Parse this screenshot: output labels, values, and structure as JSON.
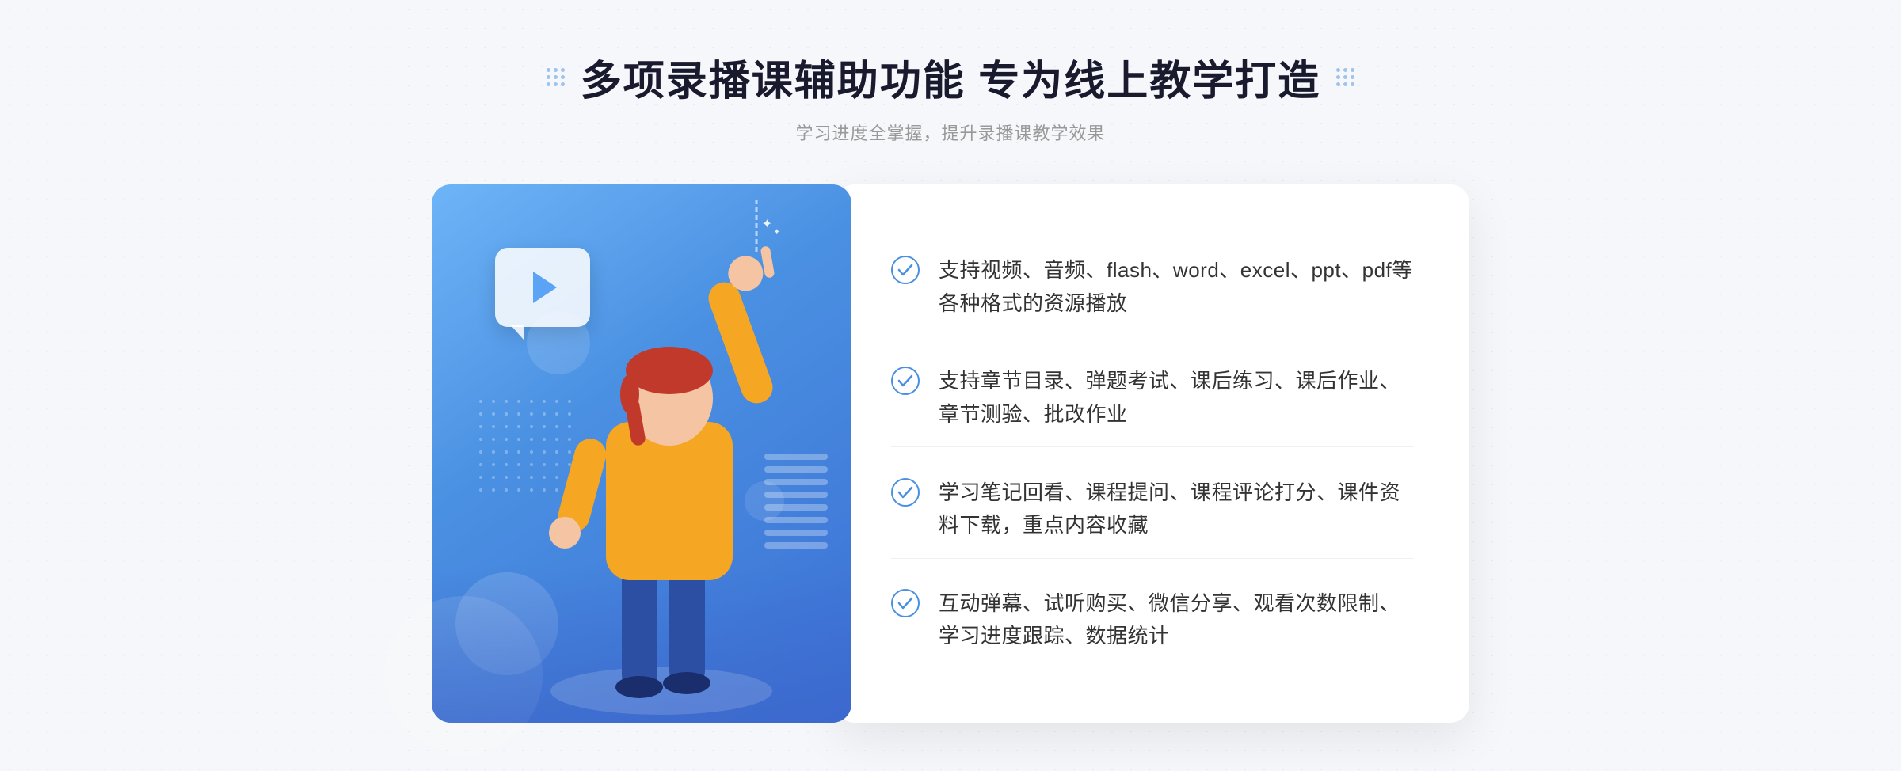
{
  "header": {
    "title": "多项录播课辅助功能 专为线上教学打造",
    "subtitle": "学习进度全掌握，提升录播课教学效果"
  },
  "features": [
    {
      "id": "feature-1",
      "text": "支持视频、音频、flash、word、excel、ppt、pdf等各种格式的资源播放"
    },
    {
      "id": "feature-2",
      "text": "支持章节目录、弹题考试、课后练习、课后作业、章节测验、批改作业"
    },
    {
      "id": "feature-3",
      "text": "学习笔记回看、课程提问、课程评论打分、课件资料下载，重点内容收藏"
    },
    {
      "id": "feature-4",
      "text": "互动弹幕、试听购买、微信分享、观看次数限制、学习进度跟踪、数据统计"
    }
  ],
  "decorative": {
    "chevron": "»",
    "sparkle_1": "✦",
    "sparkle_2": "✦"
  }
}
